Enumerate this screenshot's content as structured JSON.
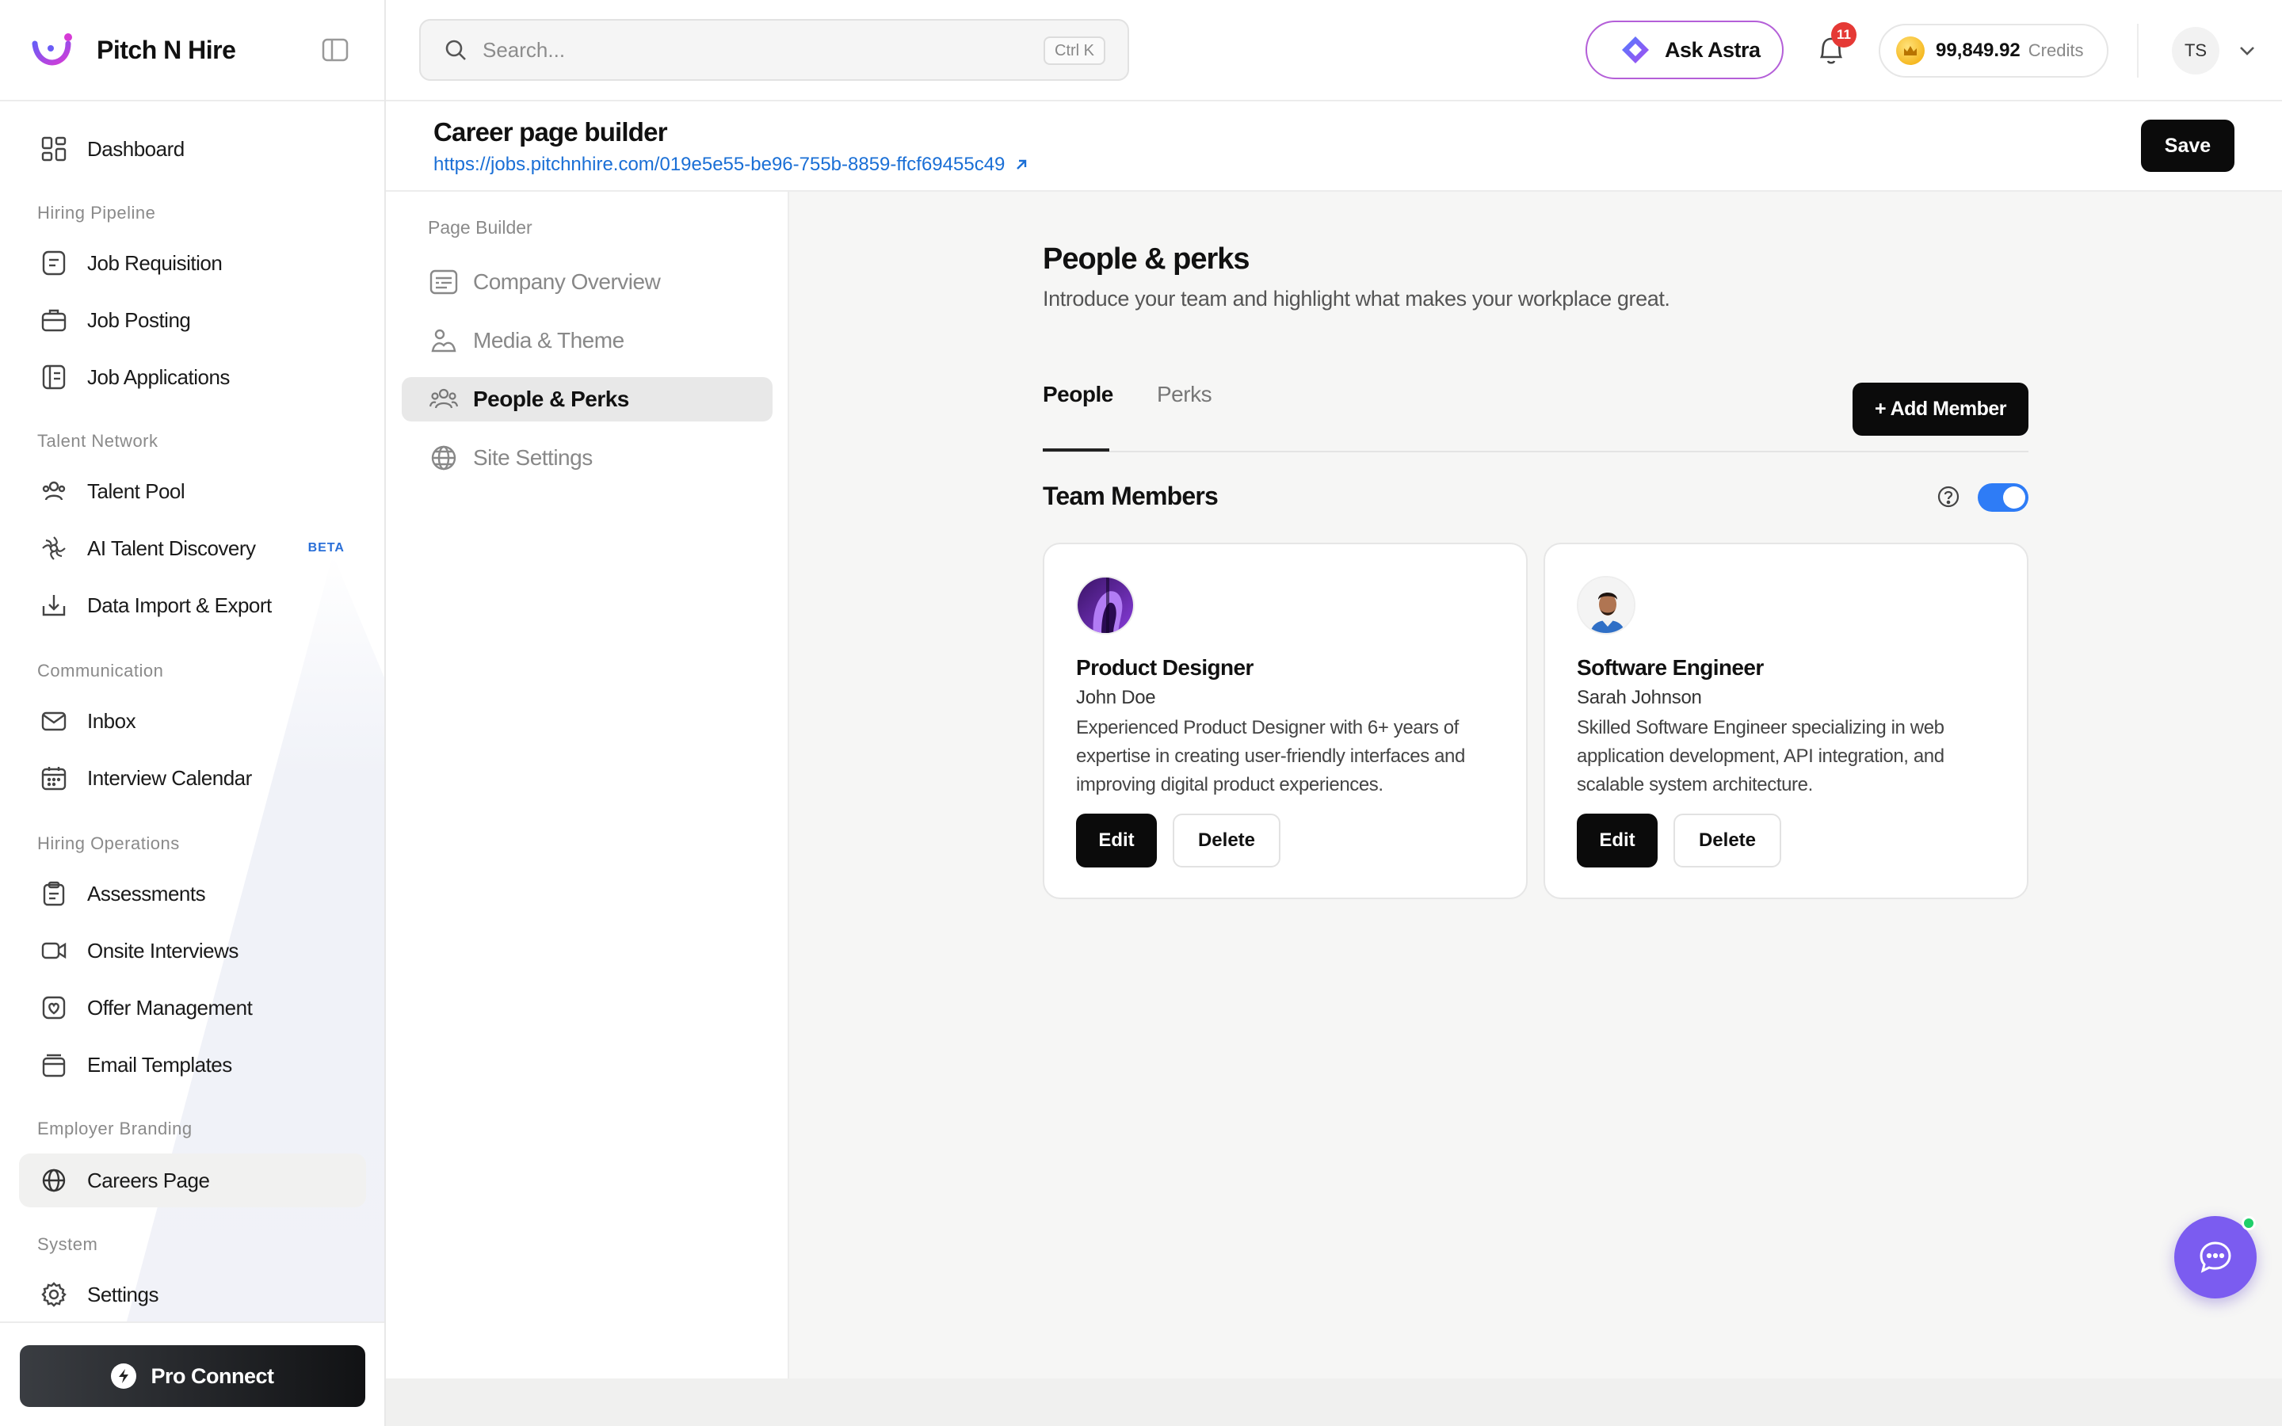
{
  "app": {
    "brand": "Pitch N Hire"
  },
  "sidebar": {
    "dashboard": "Dashboard",
    "sections": {
      "hiring_pipeline": "Hiring Pipeline",
      "talent_network": "Talent Network",
      "communication": "Communication",
      "hiring_operations": "Hiring Operations",
      "employer_branding": "Employer Branding",
      "system": "System"
    },
    "items": {
      "job_requisition": "Job Requisition",
      "job_posting": "Job Posting",
      "job_applications": "Job Applications",
      "talent_pool": "Talent Pool",
      "ai_talent_discovery": "AI Talent Discovery",
      "beta": "BETA",
      "data_import_export": "Data Import & Export",
      "inbox": "Inbox",
      "interview_calendar": "Interview Calendar",
      "assessments": "Assessments",
      "onsite_interviews": "Onsite Interviews",
      "offer_management": "Offer Management",
      "email_templates": "Email Templates",
      "careers_page": "Careers Page",
      "settings": "Settings"
    },
    "pro_connect": "Pro Connect"
  },
  "topbar": {
    "search_placeholder": "Search...",
    "search_shortcut": "Ctrl K",
    "ask_astra": "Ask Astra",
    "notification_count": "11",
    "credits_amount": "99,849.92",
    "credits_unit": "Credits",
    "user_initials": "TS"
  },
  "page": {
    "title": "Career page builder",
    "url": "https://jobs.pitchnhire.com/019e5e55-be96-755b-8859-ffcf69455c49",
    "save": "Save"
  },
  "builder": {
    "section": "Page Builder",
    "items": [
      "Company Overview",
      "Media & Theme",
      "People & Perks",
      "Site Settings"
    ],
    "active": "People & Perks"
  },
  "main": {
    "heading": "People & perks",
    "subheading": "Introduce your team and highlight what makes your workplace great.",
    "tabs": [
      "People",
      "Perks"
    ],
    "active_tab": "People",
    "add_member": "+ Add Member",
    "team_heading": "Team Members",
    "team_visible": true,
    "members": [
      {
        "role": "Product Designer",
        "name": "John Doe",
        "bio": "Experienced Product Designer with 6+ years of expertise in creating user-friendly interfaces and improving digital product experiences.",
        "edit": "Edit",
        "delete": "Delete"
      },
      {
        "role": "Software Engineer",
        "name": "Sarah Johnson",
        "bio": "Skilled Software Engineer specializing in web application development, API integration, and scalable system architecture.",
        "edit": "Edit",
        "delete": "Delete"
      }
    ]
  },
  "colors": {
    "accent_blue": "#2e7cf6",
    "link_blue": "#1a6fd6",
    "primary_black": "#0b0b0b",
    "chat_purple": "#7b5cf0",
    "badge_red": "#e53935"
  }
}
